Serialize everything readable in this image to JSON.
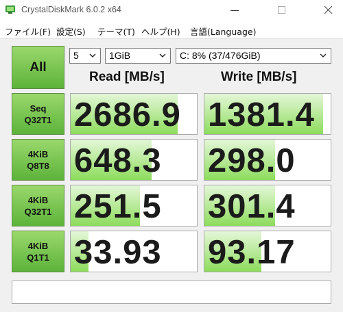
{
  "window": {
    "title": "CrystalDiskMark 6.0.2 x64"
  },
  "menu": [
    {
      "label": "ファイル(F)"
    },
    {
      "label": "設定(S)"
    },
    {
      "label": "テーマ(T)"
    },
    {
      "label": "ヘルプ(H)"
    },
    {
      "label": "言語(Language)"
    }
  ],
  "controls": {
    "all_label": "All",
    "test_count": "5",
    "test_size": "1GiB",
    "drive": "C: 8% (37/476GiB)"
  },
  "headers": {
    "read": "Read [MB/s]",
    "write": "Write [MB/s]"
  },
  "accent_color": "#6cc444",
  "rows": [
    {
      "line1": "Seq",
      "line2": "Q32T1",
      "read": "2686.9",
      "write": "1381.4",
      "read_fill": 0.85,
      "write_fill": 0.94
    },
    {
      "line1": "4KiB",
      "line2": "Q8T8",
      "read": "648.3",
      "write": "298.0",
      "read_fill": 0.64,
      "write_fill": 0.56
    },
    {
      "line1": "4KiB",
      "line2": "Q32T1",
      "read": "251.5",
      "write": "301.4",
      "read_fill": 0.55,
      "write_fill": 0.56
    },
    {
      "line1": "4KiB",
      "line2": "Q1T1",
      "read": "33.93",
      "write": "93.17",
      "read_fill": 0.14,
      "write_fill": 0.45
    }
  ],
  "comment": ""
}
